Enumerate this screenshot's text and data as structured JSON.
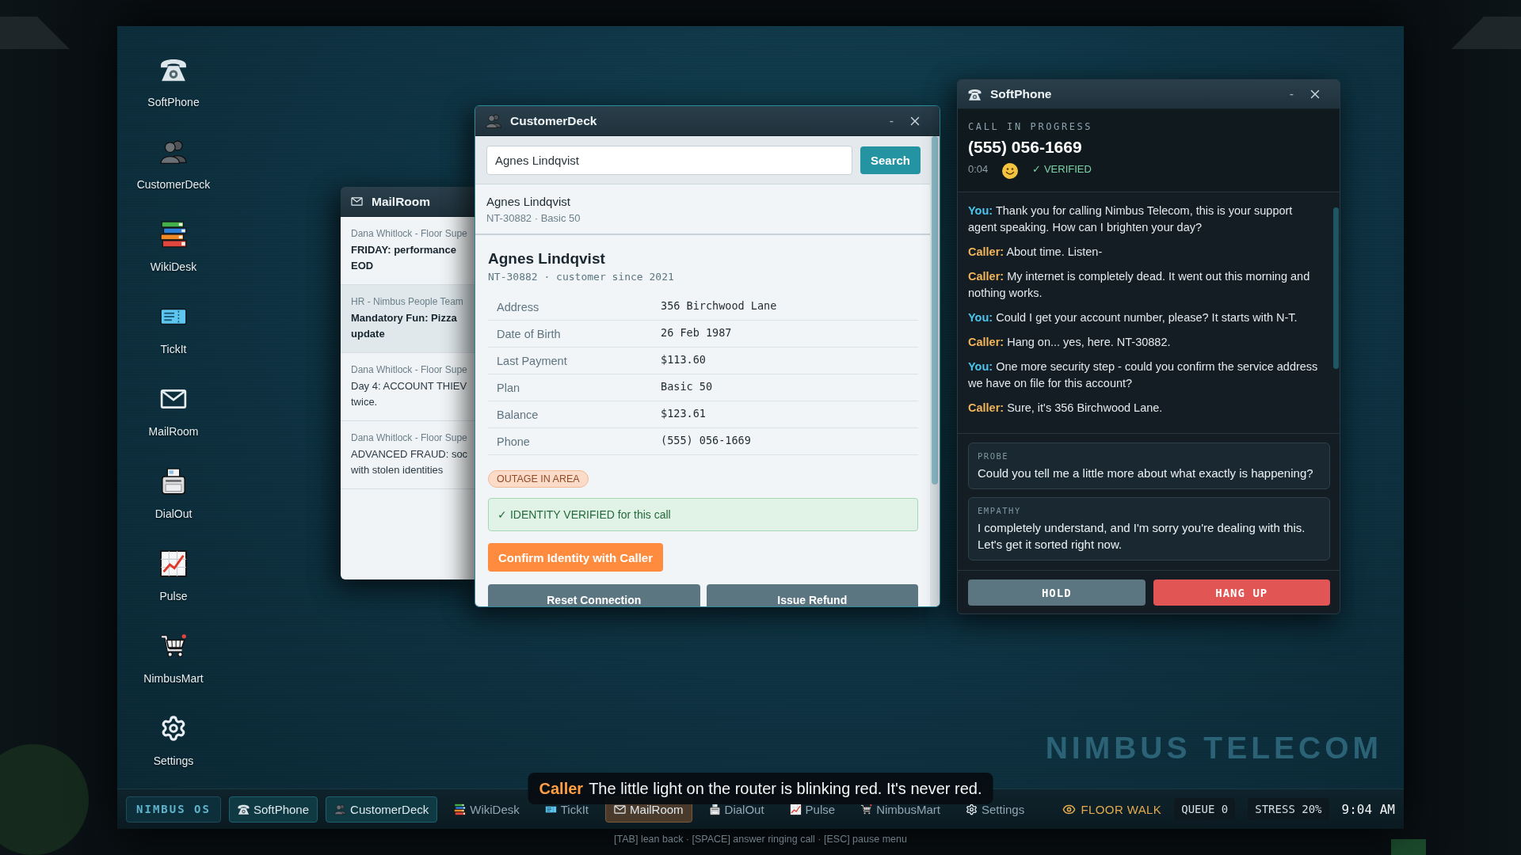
{
  "desktop": {
    "icons": [
      {
        "label": "SoftPhone",
        "kind": "phone"
      },
      {
        "label": "CustomerDeck",
        "kind": "people"
      },
      {
        "label": "WikiDesk",
        "kind": "books"
      },
      {
        "label": "TickIt",
        "kind": "ticket"
      },
      {
        "label": "MailRoom",
        "kind": "envelope"
      },
      {
        "label": "DialOut",
        "kind": "fax"
      },
      {
        "label": "Pulse",
        "kind": "chart"
      },
      {
        "label": "NimbusMart",
        "kind": "cart"
      },
      {
        "label": "Settings",
        "kind": "gear"
      }
    ],
    "wallpaper_text": "NIMBUS TELECOM"
  },
  "mailroom": {
    "title": "MailRoom",
    "messages": [
      {
        "from": "Dana Whitlock - Floor Supe",
        "subject": "FRIDAY: performance\nEOD",
        "unread": true,
        "selected": false
      },
      {
        "from": "HR - Nimbus People Team",
        "subject": "Mandatory Fun: Pizza\nupdate",
        "unread": true,
        "selected": true
      },
      {
        "from": "Dana Whitlock - Floor Supe",
        "subject": "Day 4: ACCOUNT THIEV\ntwice.",
        "unread": false,
        "selected": false
      },
      {
        "from": "Dana Whitlock - Floor Supe",
        "subject": "ADVANCED FRAUD: soc\nwith stolen identities",
        "unread": false,
        "selected": false
      }
    ]
  },
  "customerdeck": {
    "title": "CustomerDeck",
    "minimize": "-",
    "search": {
      "value": "Agnes Lindqvist",
      "button": "Search"
    },
    "results": [
      {
        "name": "Agnes Lindqvist",
        "meta": "NT-30882 · Basic 50"
      }
    ],
    "detail": {
      "name": "Agnes Lindqvist",
      "meta": "NT-30882 · customer since 2021",
      "fields": [
        {
          "label": "Address",
          "value": "356 Birchwood Lane"
        },
        {
          "label": "Date of Birth",
          "value": "26 Feb 1987"
        },
        {
          "label": "Last Payment",
          "value": "$113.60"
        },
        {
          "label": "Plan",
          "value": "Basic 50"
        },
        {
          "label": "Balance",
          "value": "$123.61"
        },
        {
          "label": "Phone",
          "value": "(555) 056-1669"
        }
      ],
      "badges": [
        "OUTAGE IN AREA"
      ],
      "verified": "✓ IDENTITY VERIFIED for this call",
      "confirm_button": "Confirm Identity with Caller",
      "actions": [
        "Reset Connection",
        "Issue Refund"
      ]
    }
  },
  "softphone": {
    "title": "SoftPhone",
    "minimize": "-",
    "status": "CALL IN PROGRESS",
    "number": "(555) 056-1669",
    "timer": "0:04",
    "verified": "✓ VERIFIED",
    "transcript": [
      {
        "kind": "agent",
        "speaker": "You:",
        "text": "Thank you for calling Nimbus Telecom, this is your support agent speaking. How can I brighten your day?"
      },
      {
        "kind": "caller",
        "speaker": "Caller:",
        "text": "About time. Listen-"
      },
      {
        "kind": "caller",
        "speaker": "Caller:",
        "text": "My internet is completely dead. It went out this morning and nothing works."
      },
      {
        "kind": "agent",
        "speaker": "You:",
        "text": "Could I get your account number, please? It starts with N-T."
      },
      {
        "kind": "caller",
        "speaker": "Caller:",
        "text": "Hang on... yes, here. NT-30882."
      },
      {
        "kind": "agent",
        "speaker": "You:",
        "text": "One more security step - could you confirm the service address we have on file for this account?"
      },
      {
        "kind": "caller",
        "speaker": "Caller:",
        "text": "Sure, it's 356 Birchwood Lane."
      }
    ],
    "replies": [
      {
        "label": "PROBE",
        "text": "Could you tell me a little more about what exactly is happening?"
      },
      {
        "label": "EMPATHY",
        "text": "I completely understand, and I'm sorry you're dealing with this. Let's get it sorted right now."
      }
    ],
    "buttons": [
      {
        "label": "HOLD",
        "kind": "hold"
      },
      {
        "label": "HANG UP",
        "kind": "hangup"
      }
    ]
  },
  "subtitle": {
    "speaker": "Caller",
    "text": "The little light on the router is blinking red. It's never red."
  },
  "taskbar": {
    "brand": "NIMBUS OS",
    "apps": [
      {
        "label": "SoftPhone",
        "kind": "phone",
        "open": true,
        "alert": false
      },
      {
        "label": "CustomerDeck",
        "kind": "people",
        "open": true,
        "alert": false
      },
      {
        "label": "WikiDesk",
        "kind": "books",
        "open": false,
        "alert": false
      },
      {
        "label": "TickIt",
        "kind": "ticket",
        "open": false,
        "alert": false
      },
      {
        "label": "MailRoom",
        "kind": "envelope",
        "open": true,
        "alert": true
      },
      {
        "label": "DialOut",
        "kind": "fax",
        "open": false,
        "alert": false
      },
      {
        "label": "Pulse",
        "kind": "chart",
        "open": false,
        "alert": false
      },
      {
        "label": "NimbusMart",
        "kind": "cart",
        "open": false,
        "alert": false
      },
      {
        "label": "Settings",
        "kind": "gear",
        "open": false,
        "alert": false
      }
    ],
    "floor_walk": "FLOOR WALK",
    "queue": "QUEUE 0",
    "stress": "STRESS 20%",
    "clock": "9:04 AM"
  },
  "hint": "[TAB] lean back · [SPACE] answer ringing call · [ESC] pause menu"
}
